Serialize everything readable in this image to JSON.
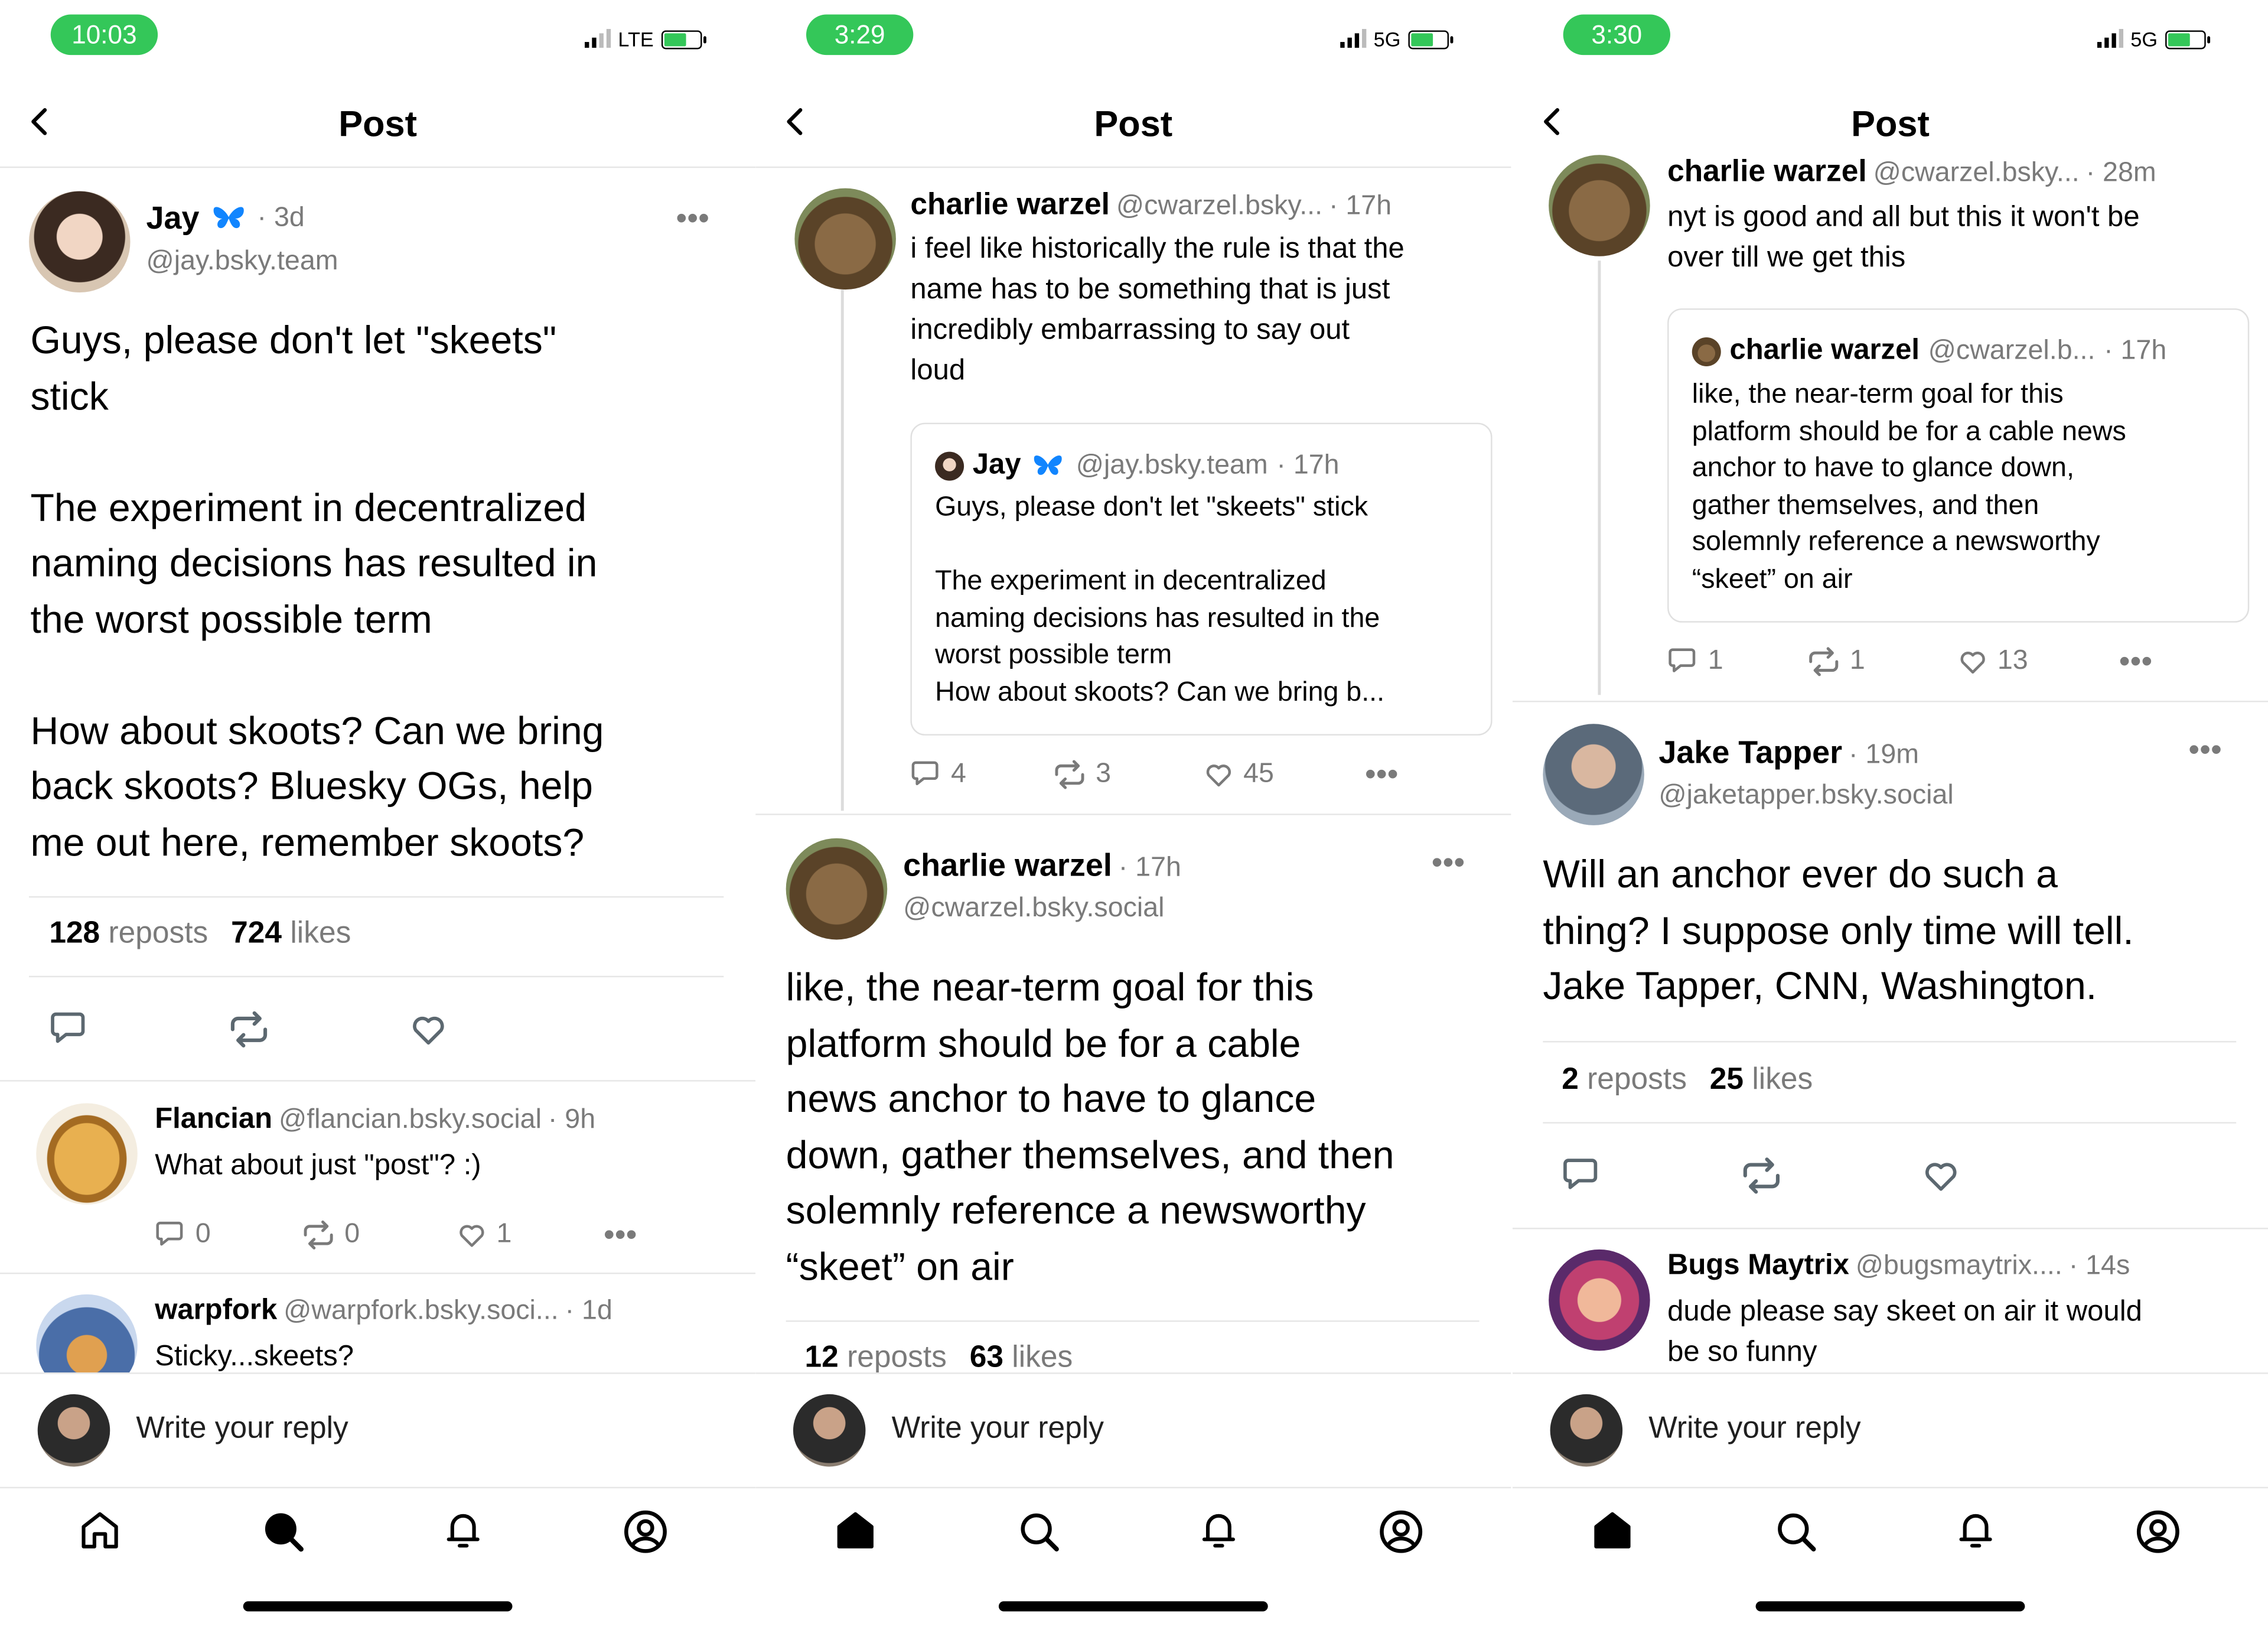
{
  "common": {
    "screen_title": "Post",
    "reply_placeholder": "Write your reply"
  },
  "screens": [
    {
      "status": {
        "time": "10:03",
        "network": "LTE"
      },
      "main_post": {
        "author": "Jay",
        "time": "· 3d",
        "handle": "@jay.bsky.team",
        "text_lines": [
          "Guys, please don't let \"skeets\"",
          "stick",
          "",
          "The experiment in decentralized",
          "naming decisions has resulted in",
          "the worst possible term",
          "",
          "How about skoots? Can we bring",
          "back skoots? Bluesky OGs, help",
          "me out here, remember skoots?"
        ],
        "reposts_count": "128",
        "reposts_label": "reposts",
        "likes_count": "724",
        "likes_label": "likes"
      },
      "replies": [
        {
          "author": "Flancian",
          "handle": "@flancian.bsky.social",
          "time": "· 9h",
          "text": "What about just \"post\"? :)",
          "comments": "0",
          "reposts": "0",
          "likes": "1"
        },
        {
          "author": "warpfork",
          "handle": "@warpfork.bsky.soci...",
          "time": "· 1d",
          "text": "Sticky...skeets?"
        }
      ]
    },
    {
      "status": {
        "time": "3:29",
        "network": "5G"
      },
      "parent_post": {
        "author": "charlie warzel",
        "handle": "@cwarzel.bsky...",
        "time": "· 17h",
        "text_lines": [
          "i feel like historically the rule is that the",
          "name has to be something that is just",
          "incredibly embarrassing to say out",
          "loud"
        ],
        "quote": {
          "author": "Jay",
          "handle": "@jay.bsky.team",
          "time": "· 17h",
          "text_lines": [
            "Guys, please don't let \"skeets\" stick",
            "",
            "The experiment in decentralized",
            "naming decisions has resulted in the",
            "worst possible term",
            "How about skoots? Can we bring b..."
          ]
        },
        "comments": "4",
        "reposts": "3",
        "likes": "45"
      },
      "main_post": {
        "author": "charlie warzel",
        "time": "· 17h",
        "handle": "@cwarzel.bsky.social",
        "text_lines": [
          "like, the near-term goal for this",
          "platform should be for a cable",
          "news anchor to have to glance",
          "down, gather themselves, and then",
          "solemnly reference a newsworthy",
          "“skeet” on air"
        ],
        "reposts_count": "12",
        "reposts_label": "reposts",
        "likes_count": "63",
        "likes_label": "likes"
      }
    },
    {
      "status": {
        "time": "3:30",
        "network": "5G"
      },
      "parent_post": {
        "author": "charlie warzel",
        "handle": "@cwarzel.bsky...",
        "time": "· 28m",
        "text_lines": [
          "nyt is good and all but this it won't be",
          "over till we get this"
        ],
        "quote": {
          "author": "charlie warzel",
          "handle": "@cwarzel.b...",
          "time": "· 17h",
          "text_lines": [
            "like, the near-term goal for this",
            "platform should be for a cable news",
            "anchor to have to glance down,",
            "gather themselves, and then",
            "solemnly reference a newsworthy",
            "“skeet” on air"
          ]
        },
        "comments": "1",
        "reposts": "1",
        "likes": "13"
      },
      "main_post": {
        "author": "Jake Tapper",
        "time": "· 19m",
        "handle": "@jaketapper.bsky.social",
        "text_lines": [
          "Will an anchor ever do such a",
          "thing? I suppose only time will tell.",
          "Jake Tapper, CNN, Washington."
        ],
        "reposts_count": "2",
        "reposts_label": "reposts",
        "likes_count": "25",
        "likes_label": "likes"
      },
      "replies": [
        {
          "author": "Bugs Maytrix",
          "handle": "@bugsmaytrix....",
          "time": "· 14s",
          "text_lines": [
            "dude please say skeet on air it would",
            "be so funny"
          ]
        }
      ]
    }
  ],
  "icons": {
    "back": "chevron-left-icon",
    "more": "more-dots-icon",
    "comment": "speech-bubble-icon",
    "repost": "repost-arrows-icon",
    "like": "heart-icon",
    "verified": "butterfly-icon",
    "tabs": [
      "home-icon",
      "search-icon",
      "notifications-bell-icon",
      "profile-icon"
    ]
  },
  "colors": {
    "status_pill": "#34c759",
    "muted": "#7a7a7a",
    "divider": "#e6e6e6"
  }
}
